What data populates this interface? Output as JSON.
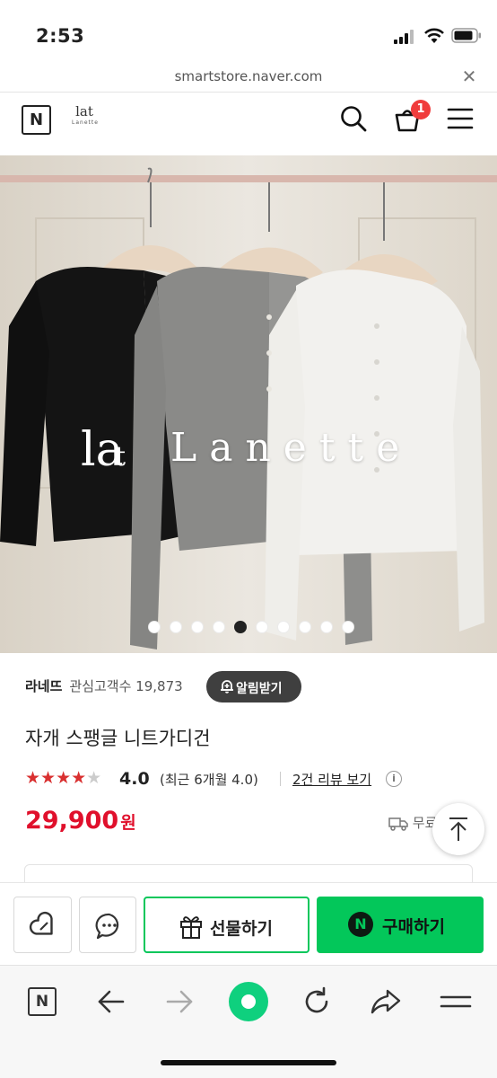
{
  "status_bar": {
    "time": "2:53"
  },
  "browser": {
    "url": "smartstore.naver.com",
    "close_label": "✕"
  },
  "header": {
    "naver_logo": "N",
    "brand_mark": "lat",
    "brand_sub": "Lanette",
    "cart_count": "1"
  },
  "hero": {
    "brand_text": "Lanette",
    "slide_count": 10,
    "active_slide": 5
  },
  "product": {
    "store_name": "라네뜨",
    "favorites_label": "관심고객수 19,873",
    "alarm_label": "알림받기",
    "title": "자개 스팽글 니트가디건",
    "stars_on": "★★★★",
    "stars_off": "★",
    "rating": "4.0",
    "recent_rating": "(최근 6개월 4.0)",
    "reviews_link": "2건 리뷰 보기",
    "info_icon": "i",
    "price": "29,900",
    "currency": "원",
    "shipping": "무료"
  },
  "actions": {
    "gift_label": "선물하기",
    "buy_label": "구매하기",
    "buy_logo": "N"
  },
  "browser_nav": {
    "naver_button": "N"
  },
  "colors": {
    "naver_green": "#03c75a",
    "price_red": "#e0102c",
    "star_red": "#d93030",
    "badge_red": "#f03c3c"
  }
}
